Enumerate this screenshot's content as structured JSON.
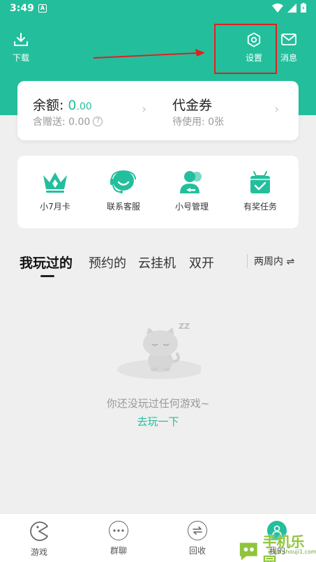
{
  "status_bar": {
    "time": "3:49",
    "notif_badge": "A"
  },
  "header": {
    "download_label": "下载",
    "settings_label": "设置",
    "messages_label": "消息"
  },
  "balance": {
    "title": "余额:",
    "amount_main": "0",
    "amount_dec": ".00",
    "gift_label": "含赠送: 0.00",
    "coupon_title": "代金券",
    "coupon_sub": "待使用: 0张"
  },
  "features": [
    {
      "label": "小7月卡",
      "icon": "crown-icon"
    },
    {
      "label": "联系客服",
      "icon": "customer-service-icon"
    },
    {
      "label": "小号管理",
      "icon": "account-manage-icon"
    },
    {
      "label": "有奖任务",
      "icon": "gift-task-icon"
    }
  ],
  "tabs": [
    {
      "label": "我玩过的"
    },
    {
      "label": "预约的"
    },
    {
      "label": "云挂机"
    },
    {
      "label": "双开"
    }
  ],
  "filter": {
    "label": "两周内 ⇌"
  },
  "empty_state": {
    "message": "你还没玩过任何游戏~",
    "action": "去玩一下",
    "illustration_text": "ZZ"
  },
  "bottom_nav": [
    {
      "label": "游戏",
      "icon": "pacman-icon"
    },
    {
      "label": "群聊",
      "icon": "chat-dots-icon"
    },
    {
      "label": "回收",
      "icon": "recycle-icon"
    },
    {
      "label": "我的",
      "icon": "profile-icon"
    }
  ],
  "watermark": {
    "text": "手机乐园",
    "url": "www.shouji1.com.cn"
  },
  "colors": {
    "accent": "#23bf9c",
    "highlight": "#e02020",
    "background": "#efefef"
  }
}
